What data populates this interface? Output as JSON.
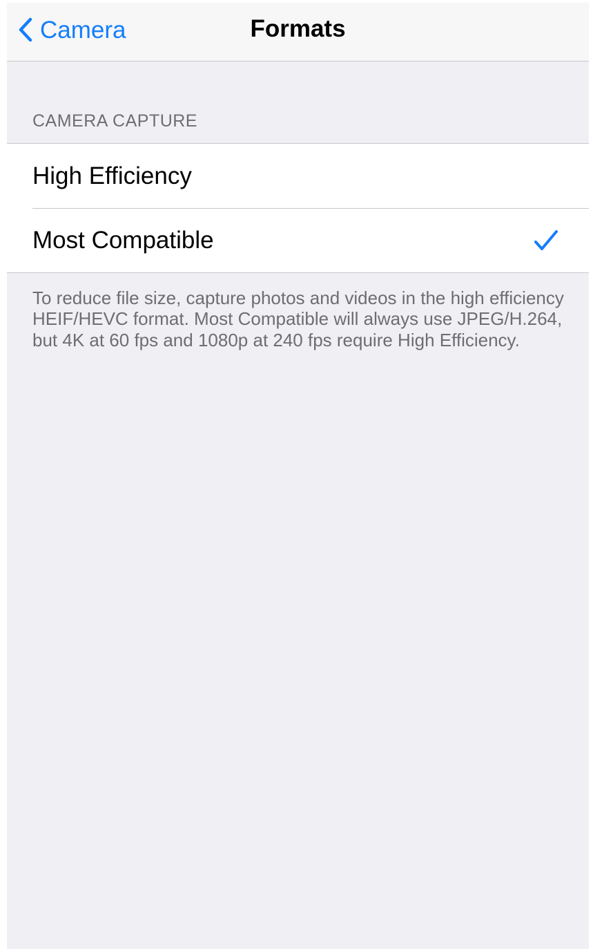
{
  "nav": {
    "back_label": "Camera",
    "title": "Formats"
  },
  "section": {
    "header": "CAMERA CAPTURE",
    "options": [
      {
        "label": "High Efficiency",
        "selected": false
      },
      {
        "label": "Most Compatible",
        "selected": true
      }
    ],
    "footer": "To reduce file size, capture photos and videos in the high efficiency HEIF/HEVC format. Most Compatible will always use JPEG/H.264, but 4K at 60 fps and 1080p at 240 fps require High Efficiency."
  },
  "icons": {
    "back": "chevron-left-icon",
    "selected": "checkmark-icon"
  },
  "colors": {
    "accent": "#147efb",
    "background": "#efeff4",
    "navbar": "#f7f7f7",
    "secondary_text": "#6d6d72",
    "separator": "#c8c7cc"
  }
}
